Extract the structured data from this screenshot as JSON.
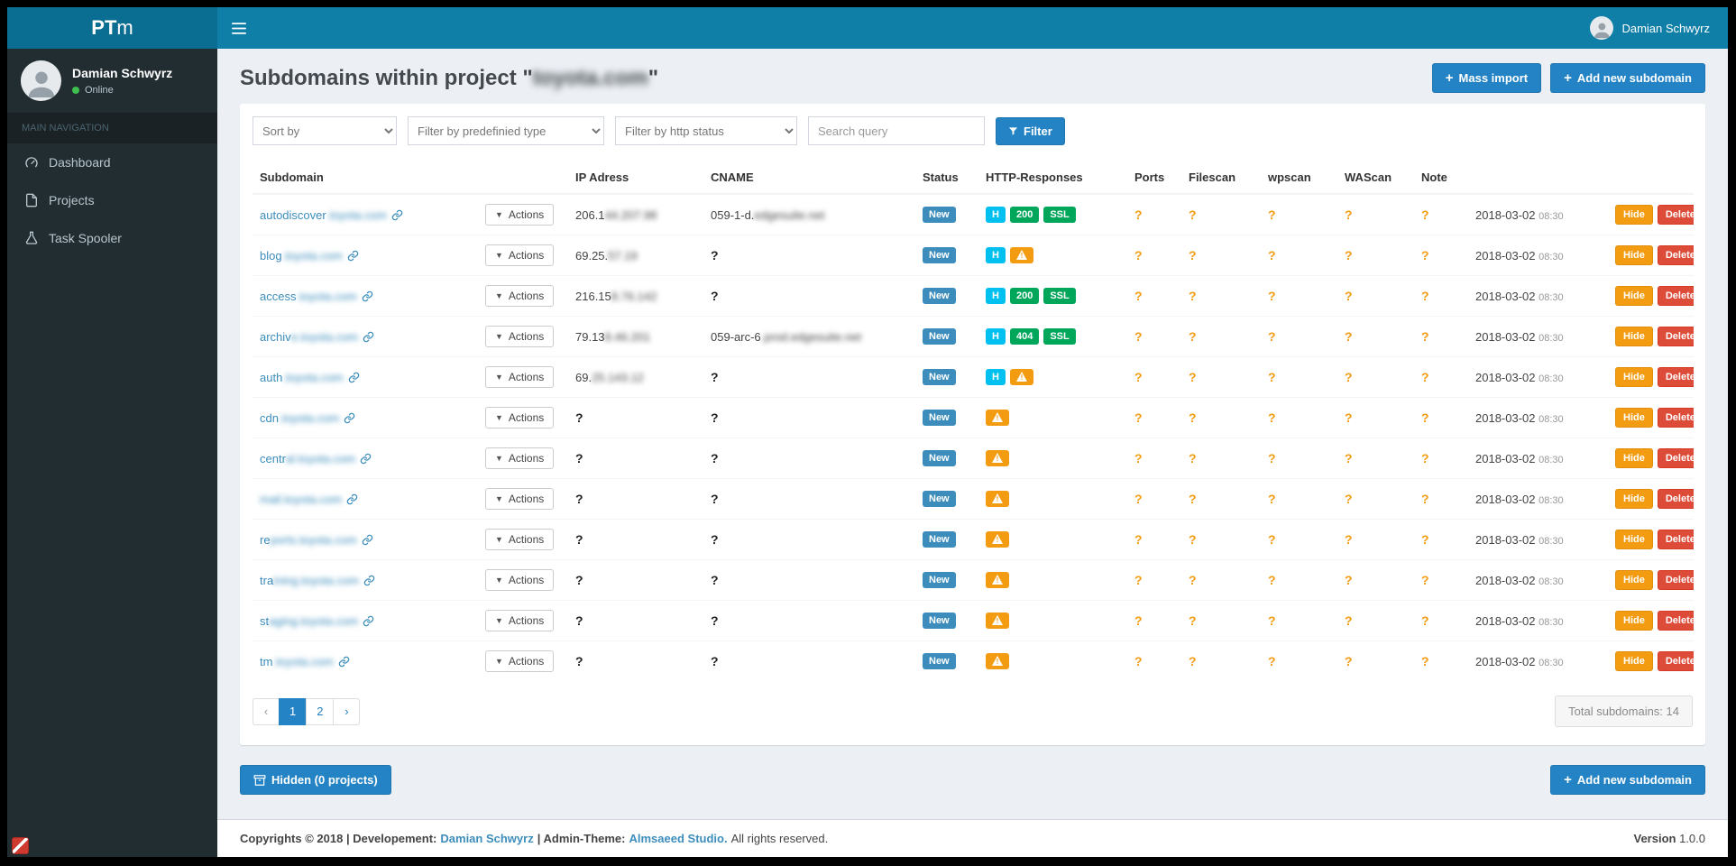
{
  "navbar": {
    "brand_bold": "PT",
    "brand_light": "m",
    "user": "Damian Schwyrz"
  },
  "sidebar": {
    "user": {
      "name": "Damian Schwyrz",
      "status": "Online"
    },
    "section": "MAIN NAVIGATION",
    "items": [
      {
        "label": "Dashboard"
      },
      {
        "label": "Projects"
      },
      {
        "label": "Task Spooler"
      }
    ]
  },
  "header": {
    "title_prefix": "Subdomains within project \"",
    "project": "toyota.com",
    "title_suffix": "\"",
    "mass_import": "Mass import",
    "add_new": "Add new subdomain"
  },
  "filters": {
    "sort": "Sort by",
    "type": "Filter by predefinied type",
    "http": "Filter by http status",
    "search_placeholder": "Search query",
    "button": "Filter"
  },
  "table": {
    "headers": [
      "Subdomain",
      "",
      "IP Adress",
      "CNAME",
      "Status",
      "HTTP-Responses",
      "Ports",
      "Filescan",
      "wpscan",
      "WAScan",
      "Note",
      "",
      ""
    ],
    "actions_label": "Actions",
    "status_label": "New",
    "hide_label": "Hide",
    "delete_label": "Delete",
    "rows": [
      {
        "subdomain": {
          "visible": "autodiscover",
          "blurred": ".toyota.com"
        },
        "ip": {
          "visible": "206.1",
          "blurred": "44.207.98"
        },
        "cname": {
          "visible": "059-1-d.",
          "blurred": "edgesuite.net"
        },
        "http_responses": [
          "H",
          "200",
          "SSL"
        ],
        "ports": "?",
        "filescan": "?",
        "wpscan": "?",
        "wascan": "?",
        "note": "?",
        "date": "2018-03-02",
        "time": "08:30"
      },
      {
        "subdomain": {
          "visible": "blog",
          "blurred": ".toyota.com"
        },
        "ip": {
          "visible": "69.25.",
          "blurred": "57.19"
        },
        "cname": {
          "visible": "?",
          "blurred": ""
        },
        "http_responses": [
          "H",
          "warn"
        ],
        "ports": "?",
        "filescan": "?",
        "wpscan": "?",
        "wascan": "?",
        "note": "?",
        "date": "2018-03-02",
        "time": "08:30"
      },
      {
        "subdomain": {
          "visible": "access",
          "blurred": ".toyota.com"
        },
        "ip": {
          "visible": "216.15",
          "blurred": "8.76.142"
        },
        "cname": {
          "visible": "?",
          "blurred": ""
        },
        "http_responses": [
          "H",
          "200",
          "SSL"
        ],
        "ports": "?",
        "filescan": "?",
        "wpscan": "?",
        "wascan": "?",
        "note": "?",
        "date": "2018-03-02",
        "time": "08:30"
      },
      {
        "subdomain": {
          "visible": "archiv",
          "blurred": "e.toyota.com"
        },
        "ip": {
          "visible": "79.13",
          "blurred": "8.46.201"
        },
        "cname": {
          "visible": "059-arc-6",
          "blurred": ".prod.edgesuite.net"
        },
        "http_responses": [
          "H",
          "404",
          "SSL"
        ],
        "ports": "?",
        "filescan": "?",
        "wpscan": "?",
        "wascan": "?",
        "note": "?",
        "date": "2018-03-02",
        "time": "08:30"
      },
      {
        "subdomain": {
          "visible": "auth",
          "blurred": ".toyota.com"
        },
        "ip": {
          "visible": "69.",
          "blurred": "25.143.12"
        },
        "cname": {
          "visible": "?",
          "blurred": ""
        },
        "http_responses": [
          "H",
          "warn"
        ],
        "ports": "?",
        "filescan": "?",
        "wpscan": "?",
        "wascan": "?",
        "note": "?",
        "date": "2018-03-02",
        "time": "08:30"
      },
      {
        "subdomain": {
          "visible": "cdn",
          "blurred": ".toyota.com"
        },
        "ip": {
          "visible": "?",
          "blurred": ""
        },
        "cname": {
          "visible": "?",
          "blurred": ""
        },
        "http_responses": [
          "warn"
        ],
        "ports": "?",
        "filescan": "?",
        "wpscan": "?",
        "wascan": "?",
        "note": "?",
        "date": "2018-03-02",
        "time": "08:30"
      },
      {
        "subdomain": {
          "visible": "centr",
          "blurred": "al.toyota.com"
        },
        "ip": {
          "visible": "?",
          "blurred": ""
        },
        "cname": {
          "visible": "?",
          "blurred": ""
        },
        "http_responses": [
          "warn"
        ],
        "ports": "?",
        "filescan": "?",
        "wpscan": "?",
        "wascan": "?",
        "note": "?",
        "date": "2018-03-02",
        "time": "08:30"
      },
      {
        "subdomain": {
          "visible": "",
          "blurred": "mail.toyota.com"
        },
        "ip": {
          "visible": "?",
          "blurred": ""
        },
        "cname": {
          "visible": "?",
          "blurred": ""
        },
        "http_responses": [
          "warn"
        ],
        "ports": "?",
        "filescan": "?",
        "wpscan": "?",
        "wascan": "?",
        "note": "?",
        "date": "2018-03-02",
        "time": "08:30"
      },
      {
        "subdomain": {
          "visible": "re",
          "blurred": "ports.toyota.com"
        },
        "ip": {
          "visible": "?",
          "blurred": ""
        },
        "cname": {
          "visible": "?",
          "blurred": ""
        },
        "http_responses": [
          "warn"
        ],
        "ports": "?",
        "filescan": "?",
        "wpscan": "?",
        "wascan": "?",
        "note": "?",
        "date": "2018-03-02",
        "time": "08:30"
      },
      {
        "subdomain": {
          "visible": "tra",
          "blurred": "ining.toyota.com"
        },
        "ip": {
          "visible": "?",
          "blurred": ""
        },
        "cname": {
          "visible": "?",
          "blurred": ""
        },
        "http_responses": [
          "warn"
        ],
        "ports": "?",
        "filescan": "?",
        "wpscan": "?",
        "wascan": "?",
        "note": "?",
        "date": "2018-03-02",
        "time": "08:30"
      },
      {
        "subdomain": {
          "visible": "st",
          "blurred": "aging.toyota.com"
        },
        "ip": {
          "visible": "?",
          "blurred": ""
        },
        "cname": {
          "visible": "?",
          "blurred": ""
        },
        "http_responses": [
          "warn"
        ],
        "ports": "?",
        "filescan": "?",
        "wpscan": "?",
        "wascan": "?",
        "note": "?",
        "date": "2018-03-02",
        "time": "08:30"
      },
      {
        "subdomain": {
          "visible": "tm",
          "blurred": ".toyota.com"
        },
        "ip": {
          "visible": "?",
          "blurred": ""
        },
        "cname": {
          "visible": "?",
          "blurred": ""
        },
        "http_responses": [
          "warn"
        ],
        "ports": "?",
        "filescan": "?",
        "wpscan": "?",
        "wascan": "?",
        "note": "?",
        "date": "2018-03-02",
        "time": "08:30"
      }
    ]
  },
  "pagination": {
    "prev": "‹",
    "pages": [
      "1",
      "2"
    ],
    "next": "›",
    "active": "1"
  },
  "summary": "Total subdomains: 14",
  "bottom": {
    "hidden_button": "Hidden (0 projects)",
    "add_new": "Add new subdomain"
  },
  "footer": {
    "copy": "Copyrights © 2018 | Developement:",
    "dev_link": "Damian Schwyrz",
    "theme_label": "| Admin-Theme:",
    "theme_link": "Almsaeed Studio.",
    "rights": "All rights reserved.",
    "version_label": "Version",
    "version": "1.0.0"
  }
}
